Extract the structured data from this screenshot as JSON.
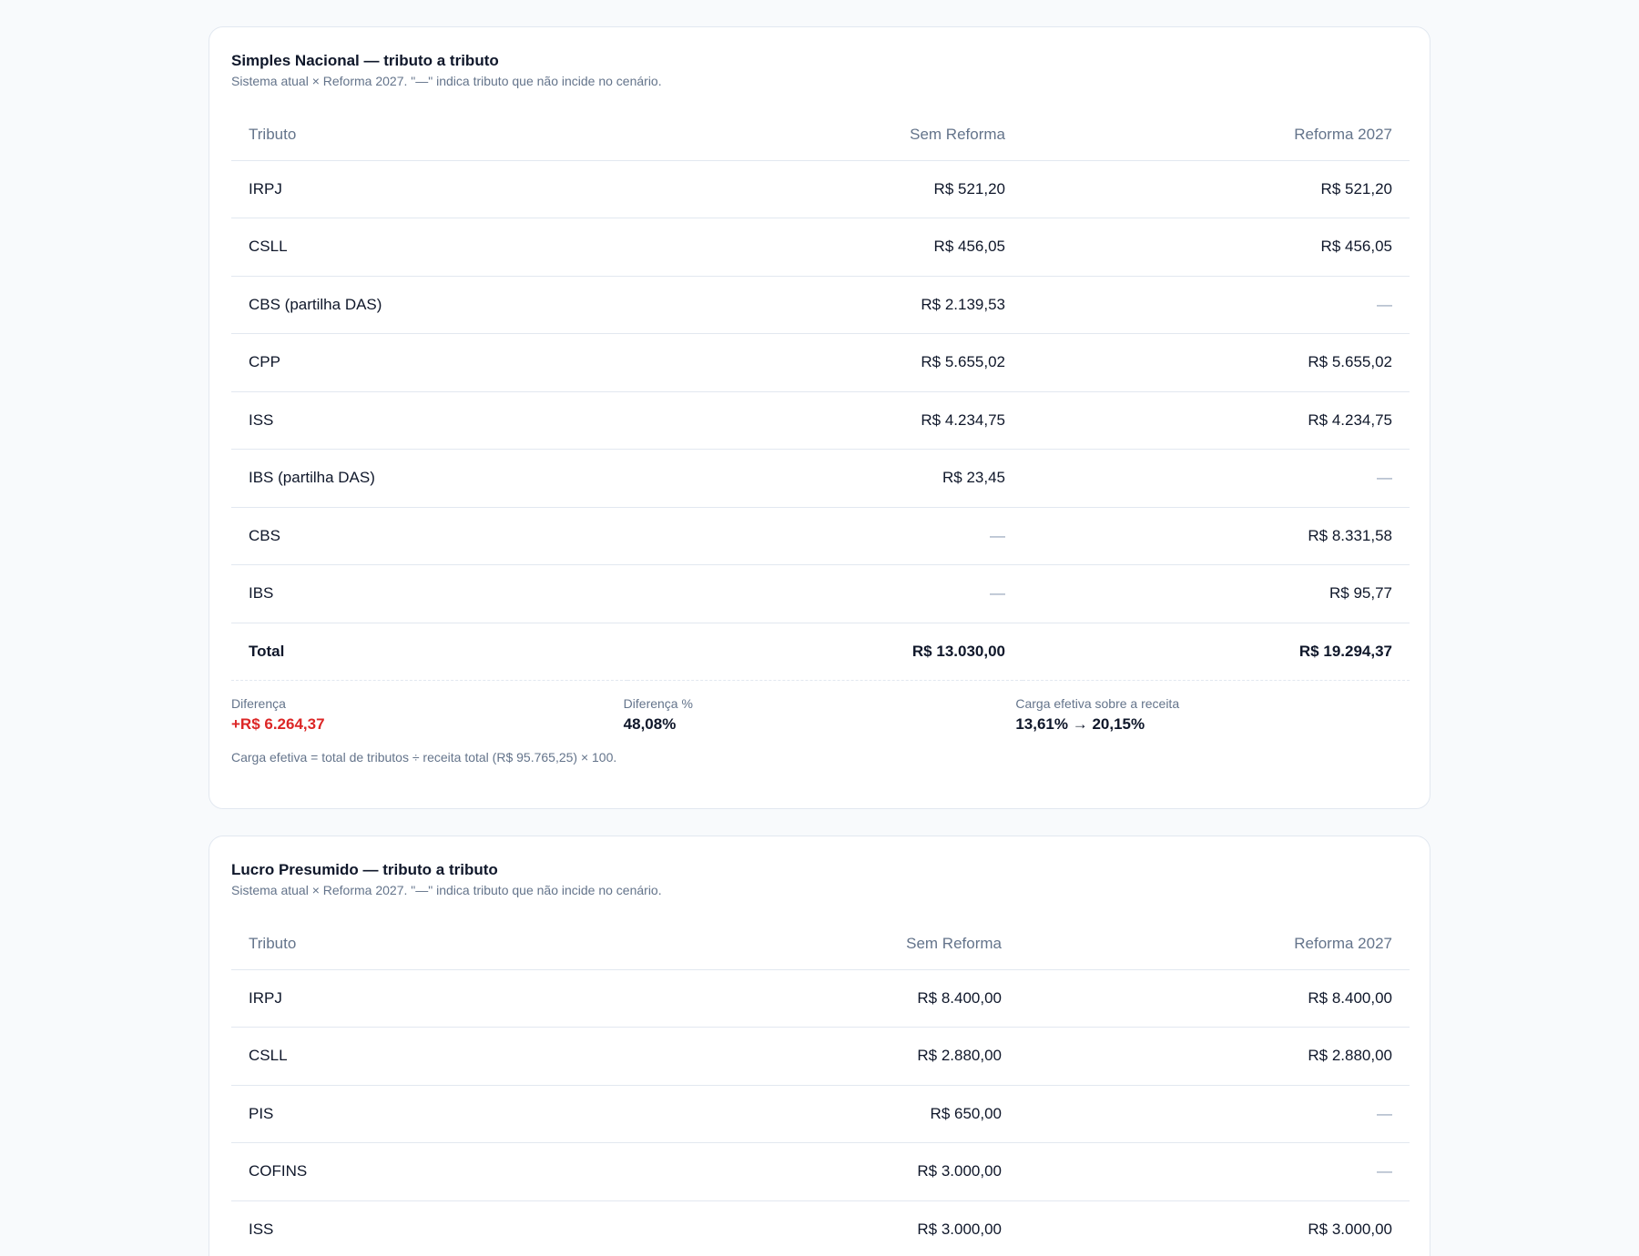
{
  "simples": {
    "title": "Simples Nacional — tributo a tributo",
    "subtitle": "Sistema atual × Reforma 2027. \"—\" indica tributo que não incide no cenário.",
    "headers": {
      "tributo": "Tributo",
      "sem": "Sem Reforma",
      "reforma": "Reforma 2027"
    },
    "rows": [
      {
        "tributo": "IRPJ",
        "sem": "R$ 521,20",
        "reforma": "R$ 521,20"
      },
      {
        "tributo": "CSLL",
        "sem": "R$ 456,05",
        "reforma": "R$ 456,05"
      },
      {
        "tributo": "CBS (partilha DAS)",
        "sem": "R$ 2.139,53",
        "reforma": "—"
      },
      {
        "tributo": "CPP",
        "sem": "R$ 5.655,02",
        "reforma": "R$ 5.655,02"
      },
      {
        "tributo": "ISS",
        "sem": "R$ 4.234,75",
        "reforma": "R$ 4.234,75"
      },
      {
        "tributo": "IBS (partilha DAS)",
        "sem": "R$ 23,45",
        "reforma": "—"
      },
      {
        "tributo": "CBS",
        "sem": "—",
        "reforma": "R$ 8.331,58"
      },
      {
        "tributo": "IBS",
        "sem": "—",
        "reforma": "R$ 95,77"
      }
    ],
    "total": {
      "tributo": "Total",
      "sem": "R$ 13.030,00",
      "reforma": "R$ 19.294,37"
    },
    "summary": {
      "diff_label": "Diferença",
      "diff_value": "+R$ 6.264,37",
      "diffpct_label": "Diferença %",
      "diffpct_value": "48,08%",
      "carga_label": "Carga efetiva sobre a receita",
      "carga_value": "13,61% → 20,15%"
    },
    "footnote": "Carga efetiva = total de tributos ÷ receita total (R$ 95.765,25) × 100.",
    "colors": {
      "negative": "#dc2626"
    }
  },
  "lucro": {
    "title": "Lucro Presumido — tributo a tributo",
    "subtitle": "Sistema atual × Reforma 2027. \"—\" indica tributo que não incide no cenário.",
    "headers": {
      "tributo": "Tributo",
      "sem": "Sem Reforma",
      "reforma": "Reforma 2027"
    },
    "rows": [
      {
        "tributo": "IRPJ",
        "sem": "R$ 8.400,00",
        "reforma": "R$ 8.400,00"
      },
      {
        "tributo": "CSLL",
        "sem": "R$ 2.880,00",
        "reforma": "R$ 2.880,00"
      },
      {
        "tributo": "PIS",
        "sem": "R$ 650,00",
        "reforma": "—"
      },
      {
        "tributo": "COFINS",
        "sem": "R$ 3.000,00",
        "reforma": "—"
      },
      {
        "tributo": "ISS",
        "sem": "R$ 3.000,00",
        "reforma": "R$ 3.000,00"
      }
    ]
  }
}
